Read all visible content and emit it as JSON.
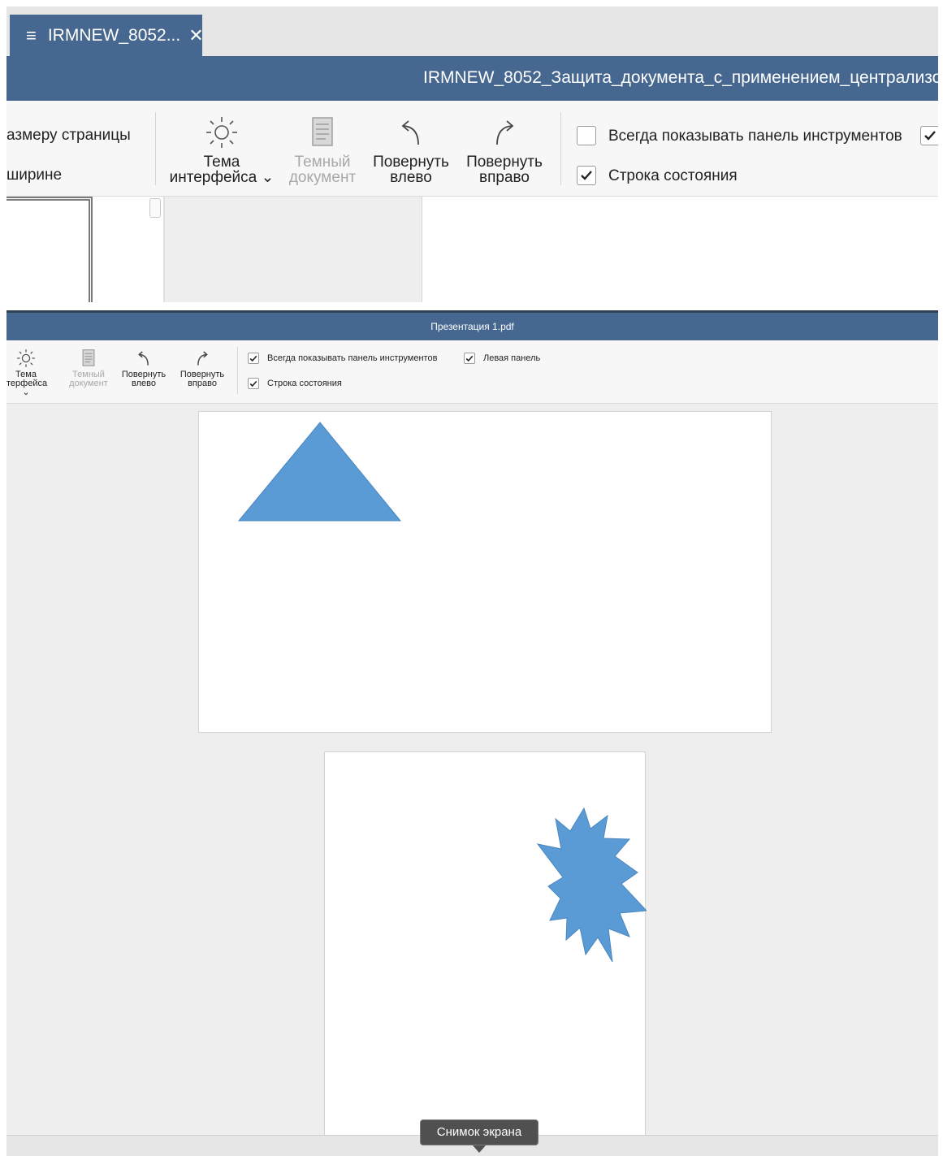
{
  "top_window": {
    "tab": {
      "menu_icon": "menu-icon",
      "label": "IRMNEW_8052...",
      "close_icon": "close-icon"
    },
    "title": "IRMNEW_8052_Защита_документа_с_применением_централизо",
    "ribbon": {
      "fit_page_label": "азмеру страницы",
      "fit_width_label": "ширине",
      "theme_label_line1": "Тема",
      "theme_label_line2": "интерфейса ⌄",
      "dark_doc_line1": "Темный",
      "dark_doc_line2": "документ",
      "rotate_left_line1": "Повернуть",
      "rotate_left_line2": "влево",
      "rotate_right_line1": "Повернуть",
      "rotate_right_line2": "вправо",
      "always_show_toolbar_label": "Всегда показывать панель инструментов",
      "always_show_toolbar_checked": false,
      "status_bar_label": "Строка состояния",
      "status_bar_checked": true,
      "left_panel_checked": true
    }
  },
  "bottom_window": {
    "title": "Презентация 1.pdf",
    "ribbon": {
      "theme_label_line1": "Тема",
      "theme_label_line2": "терфейса ⌄",
      "dark_doc_line1": "Темный",
      "dark_doc_line2": "документ",
      "rotate_left_line1": "Повернуть",
      "rotate_left_line2": "влево",
      "rotate_right_line1": "Повернуть",
      "rotate_right_line2": "вправо",
      "always_show_toolbar_label": "Всегда показывать панель инструментов",
      "always_show_toolbar_checked": true,
      "left_panel_label": "Левая панель",
      "left_panel_checked": true,
      "status_bar_label": "Строка состояния",
      "status_bar_checked": true
    },
    "pages": [
      {
        "shape": "triangle",
        "color": "#5b9bd5"
      },
      {
        "shape": "starburst",
        "color": "#5b9bd5"
      }
    ]
  },
  "tooltip": {
    "text": "Снимок экрана"
  },
  "colors": {
    "accent": "#46678f",
    "shape_fill": "#5b9bd5",
    "workspace": "#eeeeee"
  }
}
